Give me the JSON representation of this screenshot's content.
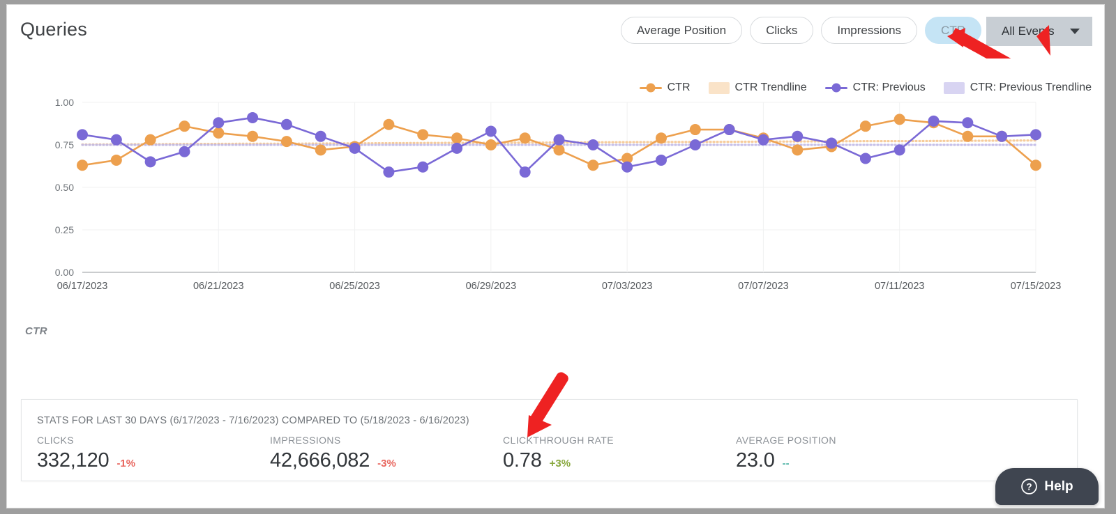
{
  "header": {
    "title": "Queries",
    "metric_buttons": [
      {
        "label": "Average Position",
        "active": false
      },
      {
        "label": "Clicks",
        "active": false
      },
      {
        "label": "Impressions",
        "active": false
      },
      {
        "label": "CTR",
        "active": true
      }
    ],
    "events_select": {
      "value": "All Events",
      "caret_icon": "chevron-down-icon"
    }
  },
  "legend": [
    {
      "label": "CTR",
      "type": "line",
      "color": "#eda04e"
    },
    {
      "label": "CTR Trendline",
      "type": "swatch",
      "color": "#fae3c8"
    },
    {
      "label": "CTR: Previous",
      "type": "line",
      "color": "#7a69d6"
    },
    {
      "label": "CTR: Previous Trendline",
      "type": "swatch",
      "color": "#d8d4f2"
    }
  ],
  "series_label": "CTR",
  "chart_data": {
    "type": "line",
    "title": "",
    "xlabel": "",
    "ylabel": "",
    "ylim": [
      0.0,
      1.0
    ],
    "yticks": [
      "0.00",
      "0.25",
      "0.50",
      "0.75",
      "1.00"
    ],
    "ytick_values": [
      0.0,
      0.25,
      0.5,
      0.75,
      1.0
    ],
    "xticks": [
      "06/17/2023",
      "06/21/2023",
      "06/25/2023",
      "06/29/2023",
      "07/03/2023",
      "07/07/2023",
      "07/11/2023",
      "07/15/2023"
    ],
    "xtick_indices": [
      0,
      4,
      8,
      12,
      16,
      20,
      24,
      28
    ],
    "grid": true,
    "legend_position": "top-right",
    "x": [
      "06/17/2023",
      "06/18/2023",
      "06/19/2023",
      "06/20/2023",
      "06/21/2023",
      "06/22/2023",
      "06/23/2023",
      "06/24/2023",
      "06/25/2023",
      "06/26/2023",
      "06/27/2023",
      "06/28/2023",
      "06/29/2023",
      "06/30/2023",
      "07/01/2023",
      "07/02/2023",
      "07/03/2023",
      "07/04/2023",
      "07/05/2023",
      "07/06/2023",
      "07/07/2023",
      "07/08/2023",
      "07/09/2023",
      "07/10/2023",
      "07/11/2023",
      "07/12/2023",
      "07/13/2023",
      "07/14/2023",
      "07/15/2023"
    ],
    "series": [
      {
        "name": "CTR",
        "color": "#eda04e",
        "values": [
          0.63,
          0.66,
          0.78,
          0.86,
          0.82,
          0.8,
          0.77,
          0.72,
          0.74,
          0.87,
          0.81,
          0.79,
          0.75,
          0.79,
          0.72,
          0.63,
          0.67,
          0.79,
          0.84,
          0.84,
          0.79,
          0.72,
          0.74,
          0.86,
          0.9,
          0.88,
          0.8,
          0.8,
          0.63
        ]
      },
      {
        "name": "CTR Trendline",
        "color": "#f5c389",
        "trend": true,
        "values": [
          0.752,
          0.753,
          0.754,
          0.755,
          0.756,
          0.757,
          0.757,
          0.758,
          0.759,
          0.76,
          0.761,
          0.762,
          0.762,
          0.763,
          0.764,
          0.765,
          0.766,
          0.767,
          0.767,
          0.768,
          0.769,
          0.77,
          0.771,
          0.772,
          0.772,
          0.773,
          0.774,
          0.775,
          0.776
        ]
      },
      {
        "name": "CTR: Previous",
        "color": "#7a69d6",
        "values": [
          0.81,
          0.78,
          0.65,
          0.71,
          0.88,
          0.91,
          0.87,
          0.8,
          0.73,
          0.59,
          0.62,
          0.73,
          0.83,
          0.59,
          0.78,
          0.75,
          0.62,
          0.66,
          0.75,
          0.84,
          0.78,
          0.8,
          0.76,
          0.67,
          0.72,
          0.89,
          0.88,
          0.8,
          0.81
        ]
      },
      {
        "name": "CTR: Previous Trendline",
        "color": "#bdb6e8",
        "trend": true,
        "values": [
          0.75,
          0.75,
          0.75,
          0.75,
          0.75,
          0.75,
          0.75,
          0.75,
          0.75,
          0.75,
          0.75,
          0.75,
          0.75,
          0.75,
          0.75,
          0.75,
          0.75,
          0.75,
          0.75,
          0.75,
          0.75,
          0.75,
          0.75,
          0.75,
          0.75,
          0.75,
          0.75,
          0.75,
          0.75
        ]
      }
    ]
  },
  "stats": {
    "heading": "STATS FOR LAST 30 DAYS (6/17/2023 - 7/16/2023) COMPARED TO (5/18/2023 - 6/16/2023)",
    "cells": [
      {
        "label": "CLICKS",
        "value": "332,120",
        "delta": "-1%",
        "delta_kind": "neg"
      },
      {
        "label": "IMPRESSIONS",
        "value": "42,666,082",
        "delta": "-3%",
        "delta_kind": "neg"
      },
      {
        "label": "CLICKTHROUGH RATE",
        "value": "0.78",
        "delta": "+3%",
        "delta_kind": "pos"
      },
      {
        "label": "AVERAGE POSITION",
        "value": "23.0",
        "delta": "--",
        "delta_kind": "neutral"
      }
    ]
  },
  "help": {
    "label": "Help",
    "icon": "question-circle-icon"
  },
  "annotations": {
    "arrow_color": "#ee2222",
    "arrows": [
      "points-at-ctr-button",
      "points-at-clickthrough-rate"
    ]
  }
}
